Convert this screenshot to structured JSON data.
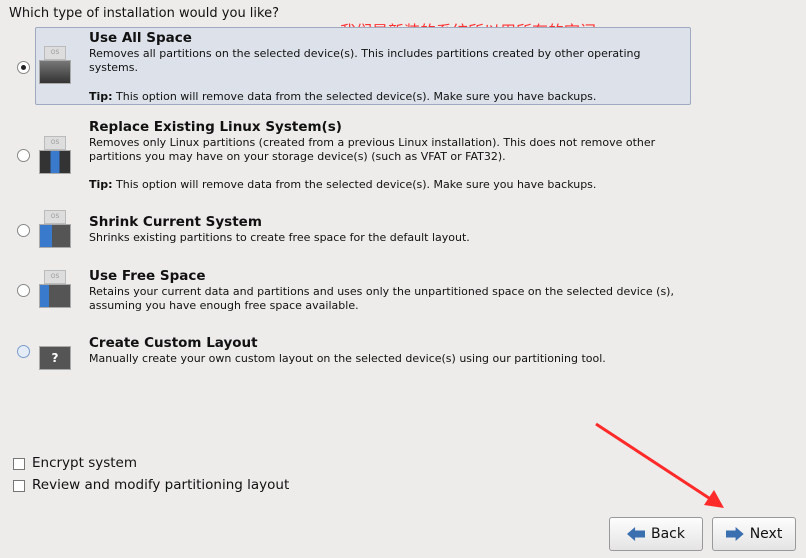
{
  "question": "Which type of installation would you like?",
  "annotation": "我们是新装的系统所以用所有的空间",
  "options": [
    {
      "title": "Use All Space",
      "desc": "Removes all partitions on the selected device(s).  This includes partitions created by other operating systems.",
      "tip_label": "Tip:",
      "tip": " This option will remove data from the selected device(s).  Make sure you have backups.",
      "selected": true
    },
    {
      "title": "Replace Existing Linux System(s)",
      "desc": "Removes only Linux partitions (created from a previous Linux installation).  This does not remove other partitions you may have on your storage device(s) (such as VFAT or FAT32).",
      "tip_label": "Tip:",
      "tip": " This option will remove data from the selected device(s).  Make sure you have backups.",
      "selected": false
    },
    {
      "title": "Shrink Current System",
      "desc": "Shrinks existing partitions to create free space for the default layout.",
      "selected": false
    },
    {
      "title": "Use Free Space",
      "desc": "Retains your current data and partitions and uses only the unpartitioned space on the selected device (s), assuming you have enough free space available.",
      "selected": false
    },
    {
      "title": "Create Custom Layout",
      "desc": "Manually create your own custom layout on the selected device(s) using our partitioning tool.",
      "selected": false
    }
  ],
  "os_label": "OS",
  "question_mark": "?",
  "checkboxes": [
    {
      "label": "Encrypt system",
      "checked": false
    },
    {
      "label": "Review and modify partitioning layout",
      "checked": false
    }
  ],
  "buttons": {
    "back": "Back",
    "next": "Next"
  },
  "colors": {
    "annotation": "#ff3030",
    "selection": "#dde2ea"
  }
}
